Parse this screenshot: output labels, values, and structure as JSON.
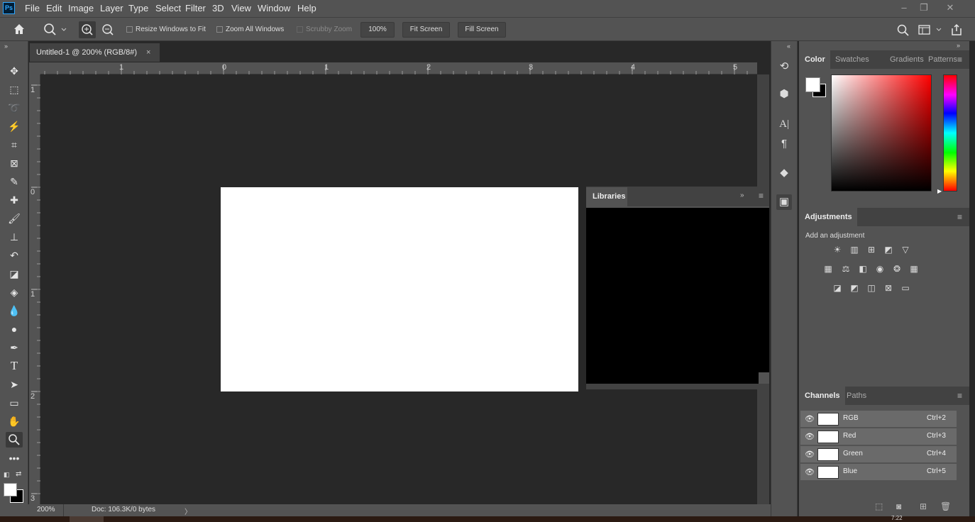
{
  "app": {
    "logo": "Ps"
  },
  "menu": [
    "File",
    "Edit",
    "Image",
    "Layer",
    "Type",
    "Select",
    "Filter",
    "3D",
    "View",
    "Window",
    "Help"
  ],
  "window_controls": {
    "minimize": "–",
    "restore": "❐",
    "close": "✕"
  },
  "options": {
    "resize_windows": "Resize Windows to Fit",
    "zoom_all": "Zoom All Windows",
    "scrubby": "Scrubby Zoom",
    "zoom_value": "100%",
    "fit_screen": "Fit Screen",
    "fill_screen": "Fill Screen"
  },
  "document": {
    "tab_title": "Untitled-1 @ 200% (RGB/8#)",
    "close": "×"
  },
  "hruler_labels": [
    "1",
    "0",
    "1",
    "2",
    "3",
    "4",
    "5"
  ],
  "vruler_labels": [
    "1",
    "0",
    "1",
    "2",
    "3"
  ],
  "status": {
    "zoom": "200%",
    "doc": "Doc: 106.3K/0 bytes",
    "arrow": "〉"
  },
  "libraries": {
    "title": "Libraries"
  },
  "color_panel": {
    "tabs": [
      "Color",
      "Swatches",
      "Gradients",
      "Patterns"
    ]
  },
  "adjustments": {
    "title": "Adjustments",
    "hint": "Add an adjustment"
  },
  "channels": {
    "tabs": [
      "Channels",
      "Paths"
    ],
    "rows": [
      {
        "name": "RGB",
        "key": "Ctrl+2"
      },
      {
        "name": "Red",
        "key": "Ctrl+3"
      },
      {
        "name": "Green",
        "key": "Ctrl+4"
      },
      {
        "name": "Blue",
        "key": "Ctrl+5"
      }
    ]
  },
  "taskbar": {
    "time": "7:22"
  }
}
